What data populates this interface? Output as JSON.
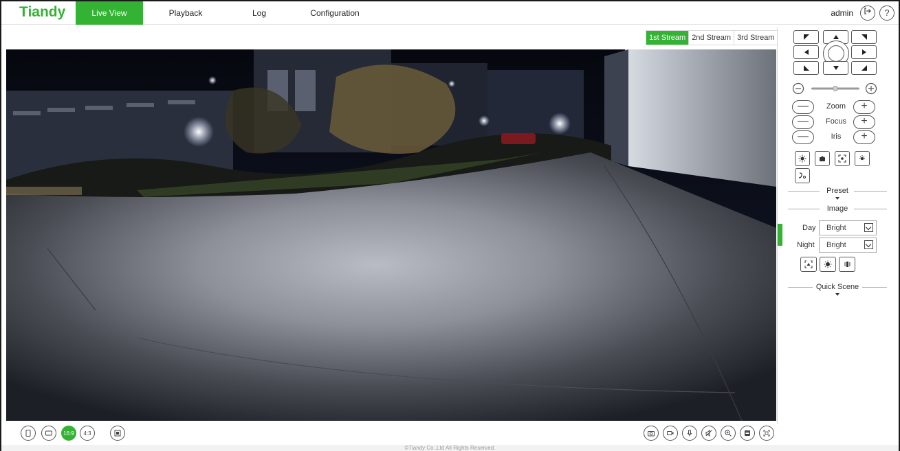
{
  "brand": {
    "logo_text": "Tiandy",
    "accent": "#33b233"
  },
  "nav": {
    "items": [
      "Live View",
      "Playback",
      "Log",
      "Configuration"
    ],
    "active": "Live View"
  },
  "header": {
    "username": "admin",
    "logout_icon": "logout-icon",
    "help_icon": "help-icon",
    "help_glyph": "?"
  },
  "streams": {
    "items": [
      "1st Stream",
      "2nd Stream",
      "3rd Stream"
    ],
    "active": "1st Stream"
  },
  "bottom_toolbar": {
    "left": [
      {
        "icon": "rotate-view-icon"
      },
      {
        "icon": "fit-window-icon"
      },
      {
        "icon": "ratio-16-9-icon",
        "label": "16:9"
      },
      {
        "icon": "ratio-4-3-icon",
        "label": "4:3"
      },
      {
        "icon": "original-size-icon"
      }
    ],
    "right": [
      {
        "icon": "snapshot-icon"
      },
      {
        "icon": "record-icon"
      },
      {
        "icon": "microphone-icon"
      },
      {
        "icon": "mute-icon"
      },
      {
        "icon": "digital-zoom-icon"
      },
      {
        "icon": "capture-list-icon"
      },
      {
        "icon": "fullscreen-icon"
      }
    ]
  },
  "footer": {
    "text": "©Tiandy Co.,Ltd All Rights Reserved."
  },
  "ptz": {
    "zoom_label": "Zoom",
    "focus_label": "Focus",
    "iris_label": "Iris",
    "minus": "—",
    "plus": "+",
    "tools": [
      "light-icon",
      "wiper-icon",
      "auto-focus-icon",
      "lamp-icon",
      "ir-icon"
    ]
  },
  "sections": {
    "preset": "Preset",
    "image": "Image",
    "quick_scene": "Quick Scene"
  },
  "image": {
    "day_label": "Day",
    "day_value": "Bright",
    "night_label": "Night",
    "night_value": "Bright",
    "tools": [
      "wdr-icon",
      "noise-reduction-icon",
      "backlight-icon"
    ]
  }
}
